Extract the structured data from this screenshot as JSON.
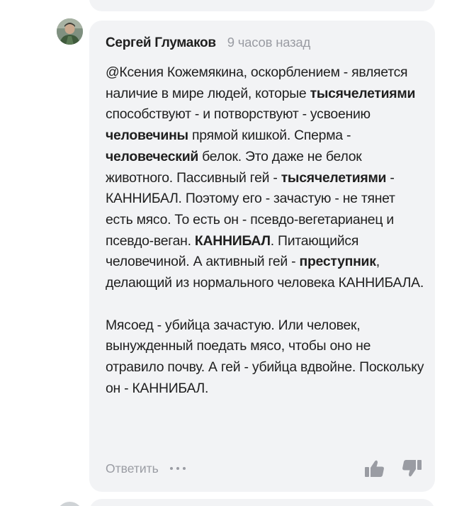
{
  "comment": {
    "author": "Сергей Глумаков",
    "time": "9 часов назад",
    "paragraph1": [
      {
        "t": "@Ксения Кожемякина, оскорблением - является наличие в мире людей, которые ",
        "b": false
      },
      {
        "t": "тысячелетиями",
        "b": true
      },
      {
        "t": " способствуют - и потворствуют - усвоению ",
        "b": false
      },
      {
        "t": "человечины",
        "b": true
      },
      {
        "t": " прямой кишкой. Сперма - ",
        "b": false
      },
      {
        "t": "человеческий",
        "b": true
      },
      {
        "t": " белок. Это даже не белок животного. Пассивный гей - ",
        "b": false
      },
      {
        "t": "тысячелетиями",
        "b": true
      },
      {
        "t": " - КАННИБАЛ. Поэтому его - зачастую - не тянет есть мясо. То есть он - псевдо-вегетарианец и псевдо-веган. ",
        "b": false
      },
      {
        "t": "КАННИБАЛ",
        "b": true
      },
      {
        "t": ". Питающийся человечиной. А активный гей - ",
        "b": false
      },
      {
        "t": "преступник",
        "b": true
      },
      {
        "t": ", делающий из нормального человека КАННИБАЛА.",
        "b": false
      }
    ],
    "paragraph2": "Мясоед - убийца зачастую. Или человек, вынужденный поедать мясо, чтобы оно не отравило почву. А гей - убийца вдвойне. Поскольку он - КАННИБАЛ.",
    "reply_label": "Ответить",
    "more_icon": "more-dots-icon",
    "like_icon": "thumbs-up-icon",
    "dislike_icon": "thumbs-down-icon"
  },
  "colors": {
    "card_bg": "#f2f3f5",
    "text": "#1f1f1f",
    "muted": "#9a9ca3"
  }
}
